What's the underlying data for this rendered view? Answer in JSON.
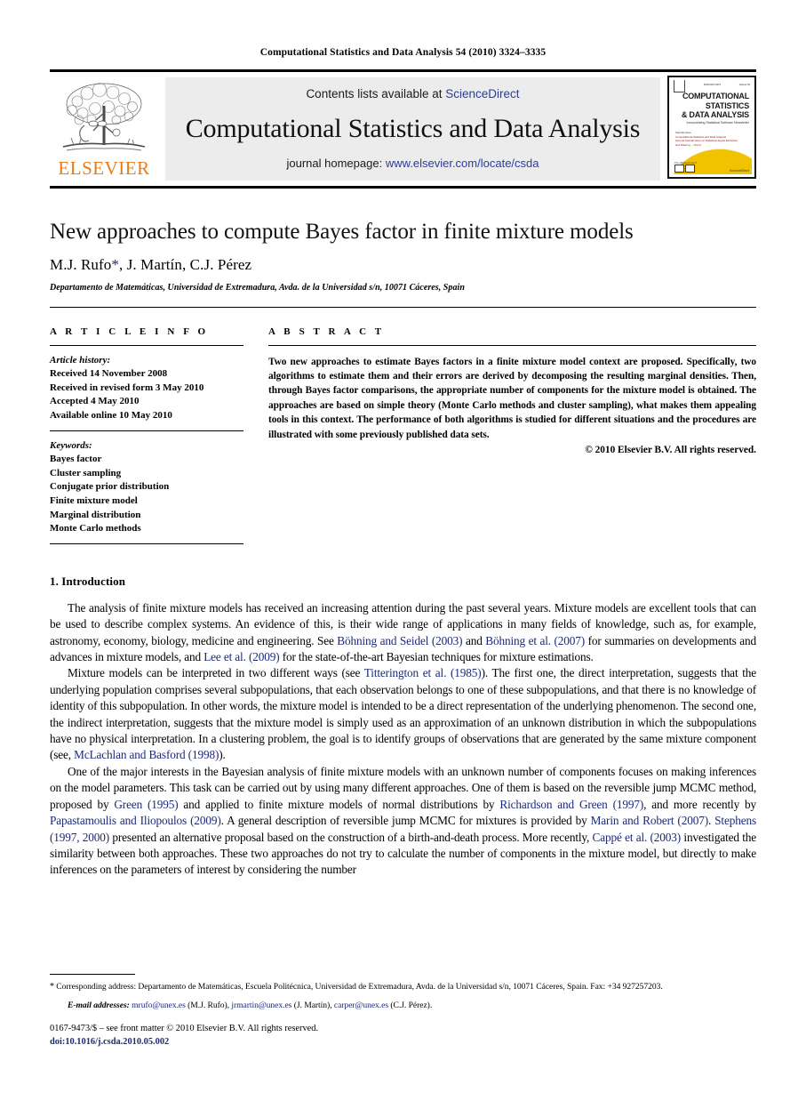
{
  "running_head": "Computational Statistics and Data Analysis 54 (2010) 3324–3335",
  "masthead": {
    "publisher_name": "ELSEVIER",
    "contents_prefix": "Contents lists available at ",
    "contents_link": "ScienceDirect",
    "journal_title": "Computational Statistics and Data Analysis",
    "homepage_prefix": "journal homepage: ",
    "homepage_link": "www.elsevier.com/locate/csda",
    "cover": {
      "title_line1": "COMPUTATIONAL",
      "title_line2": "STATISTICS",
      "title_line3": "& DATA ANALYSIS",
      "subtitle": "Incorporating Statistical Software Newsletter",
      "top_left": "ISSN 0167-9473",
      "top_right": "Volume 54",
      "section_label": "Special Issue",
      "red_line1": "Computational Statistics and Data Analysis",
      "red_line2": "Second Special Issue on Statistical Signal Extraction",
      "red_line3": "and Filtering — Part II",
      "issn_note": "The official journal of",
      "sd_label": "ScienceDirect"
    }
  },
  "article": {
    "title": "New approaches to compute Bayes factor in finite mixture models",
    "authors": "M.J. Rufo",
    "authors_rest": ", J. Martín, C.J. Pérez",
    "corresponding_marker": "*",
    "affiliation": "Departamento de Matemáticas, Universidad de Extremadura, Avda. de la Universidad s/n, 10071 Cáceres, Spain"
  },
  "article_info": {
    "heading": "A R T I C L E   I N F O",
    "history_label": "Article history:",
    "history": [
      "Received 14 November 2008",
      "Received in revised form 3 May 2010",
      "Accepted 4 May 2010",
      "Available online 10 May 2010"
    ],
    "keywords_label": "Keywords:",
    "keywords": [
      "Bayes factor",
      "Cluster sampling",
      "Conjugate prior distribution",
      "Finite mixture model",
      "Marginal distribution",
      "Monte Carlo methods"
    ]
  },
  "abstract": {
    "heading": "A B S T R A C T",
    "text": "Two new approaches to estimate Bayes factors in a finite mixture model context are proposed. Specifically, two algorithms to estimate them and their errors are derived by decomposing the resulting marginal densities. Then, through Bayes factor comparisons, the appropriate number of components for the mixture model is obtained. The approaches are based on simple theory (Monte Carlo methods and cluster sampling), what makes them appealing tools in this context. The performance of both algorithms is studied for different situations and the procedures are illustrated with some previously published data sets.",
    "copyright": "© 2010 Elsevier B.V. All rights reserved."
  },
  "introduction": {
    "heading": "1. Introduction",
    "p1": {
      "a": "The analysis of finite mixture models has received an increasing attention during the past several years. Mixture models are excellent tools that can be used to describe complex systems. An evidence of this, is their wide range of applications in many fields of knowledge, such as, for example, astronomy, economy, biology, medicine and engineering. See ",
      "c1": "Böhning and Seidel (2003)",
      "b": " and ",
      "c2": "Böhning et al. (2007)",
      "c": " for summaries on developments and advances in mixture models, and ",
      "c3": "Lee et al. (2009)",
      "d": " for the state-of-the-art Bayesian techniques for mixture estimations."
    },
    "p2": {
      "a": "Mixture models can be interpreted in two different ways (see ",
      "c1": "Titterington et al. (1985)",
      "b": "). The first one, the direct interpretation, suggests that the underlying population comprises several subpopulations, that each observation belongs to one of these subpopulations, and that there is no knowledge of identity of this subpopulation. In other words, the mixture model is intended to be a direct representation of the underlying phenomenon. The second one, the indirect interpretation, suggests that the mixture model is simply used as an approximation of an unknown distribution in which the subpopulations have no physical interpretation. In a clustering problem, the goal is to identify groups of observations that are generated by the same mixture component (see, ",
      "c2": "McLachlan and Basford (1998)",
      "c": ")."
    },
    "p3": {
      "a": "One of the major interests in the Bayesian analysis of finite mixture models with an unknown number of components focuses on making inferences on the model parameters. This task can be carried out by using many different approaches. One of them is based on the reversible jump MCMC method, proposed by ",
      "c1": "Green (1995)",
      "b": " and applied to finite mixture models of normal distributions by ",
      "c2": "Richardson and Green (1997)",
      "c": ", and more recently by ",
      "c3": "Papastamoulis and Iliopoulos (2009)",
      "d": ". A general description of reversible jump MCMC for mixtures is provided by ",
      "c4": "Marin and Robert (2007)",
      "e": ". ",
      "c5": "Stephens (1997, 2000)",
      "f": " presented an alternative proposal based on the construction of a birth-and-death process. More recently, ",
      "c6": "Cappé et al. (2003)",
      "g": " investigated the similarity between both approaches. These two approaches do not try to calculate the number of components in the mixture model, but directly to make inferences on the parameters of interest by considering the number"
    }
  },
  "footnotes": {
    "corresponding_marker": "*",
    "corresponding": " Corresponding address: Departamento de Matemáticas, Escuela Politécnica, Universidad de Extremadura, Avda. de la Universidad s/n, 10071 Cáceres, Spain. Fax: +34 927257203.",
    "email_label": "E-mail addresses:",
    "emails": [
      {
        "address": "mrufo@unex.es",
        "person": " (M.J. Rufo)"
      },
      {
        "address": "jrmartin@unex.es",
        "person": " (J. Martín)"
      },
      {
        "address": "carper@unex.es",
        "person": " (C.J. Pérez)"
      }
    ],
    "imprint": "0167-9473/$ – see front matter © 2010 Elsevier B.V. All rights reserved.",
    "doi": "doi:10.1016/j.csda.2010.05.002"
  },
  "colors": {
    "link": "#2a3d9e",
    "citation": "#1b2a7a",
    "elsevier_orange": "#E87B16",
    "masthead_bg": "#ececec",
    "cover_yellow": "#f0c200"
  }
}
